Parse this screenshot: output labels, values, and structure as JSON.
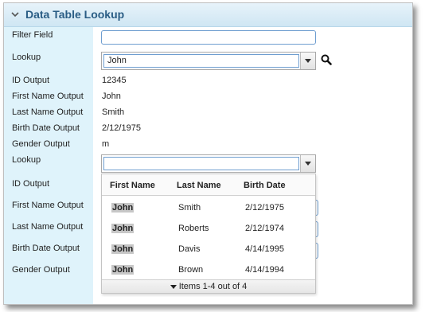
{
  "header": {
    "title": "Data Table Lookup"
  },
  "labels": {
    "filter_field": "Filter Field",
    "lookup": "Lookup",
    "id_output": "ID Output",
    "first_name_output": "First Name Output",
    "last_name_output": "Last Name Output",
    "birth_date_output": "Birth Date Output",
    "gender_output": "Gender Output"
  },
  "values": {
    "filter_value": "",
    "lookup1": "John",
    "id": "12345",
    "first_name": "John",
    "last_name": "Smith",
    "birth_date": "2/12/1975",
    "gender": "m",
    "lookup2": ""
  },
  "dropdown": {
    "columns": [
      "First Name",
      "Last Name",
      "Birth Date"
    ],
    "rows": [
      {
        "first": "John",
        "last": "Smith",
        "birth": "2/12/1975"
      },
      {
        "first": "John",
        "last": "Roberts",
        "birth": "2/12/1974"
      },
      {
        "first": "John",
        "last": "Davis",
        "birth": "4/14/1995"
      },
      {
        "first": "John",
        "last": "Brown",
        "birth": "4/14/1994"
      }
    ],
    "pager": "Items 1-4 out of 4"
  },
  "icons": {
    "collapse": "chevron-down-icon",
    "search": "search-icon",
    "dropdown": "triangle-down-icon"
  },
  "colors": {
    "header_text": "#2a5d85",
    "label_bg": "#dff3fb",
    "field_border": "#6f9ed0"
  }
}
